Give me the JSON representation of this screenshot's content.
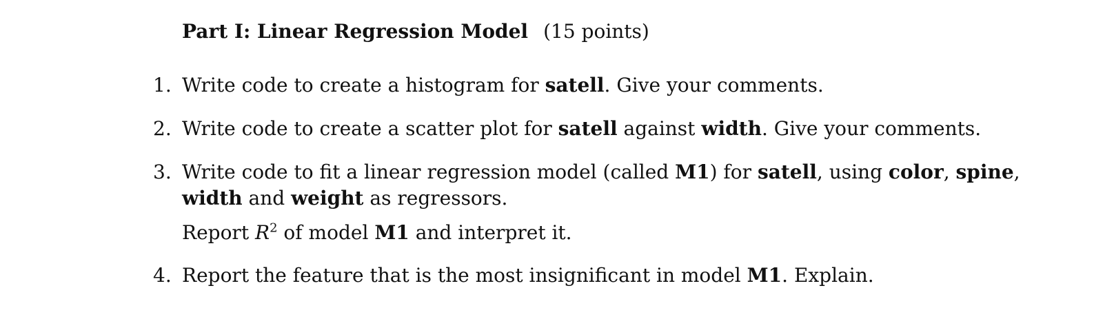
{
  "heading": {
    "title": "Part I: Linear Regression Model",
    "points": "(15 points)"
  },
  "items": [
    {
      "number": "1.",
      "t1": "Write code to create a histogram for ",
      "b1": "satell",
      "t2": ". Give your comments."
    },
    {
      "number": "2.",
      "t1": "Write code to create a scatter plot for ",
      "b1": "satell",
      "t2": " against ",
      "b2": "width",
      "t3": ". Give your comments."
    },
    {
      "number": "3.",
      "t1": "Write code to fit a linear regression model (called ",
      "b1": "M1",
      "t2": ") for ",
      "b2": "satell",
      "t3": ", using ",
      "b3": "color",
      "t4": ", ",
      "b4": "spine",
      "t5": ",",
      "b5": "width",
      "t6": " and ",
      "b6": "weight",
      "t7": " as regressors.",
      "p2_t1": "Report ",
      "p2_math": "R",
      "p2_sup": "2",
      "p2_t2": " of model ",
      "p2_b1": "M1",
      "p2_t3": " and interpret it."
    },
    {
      "number": "4.",
      "t1": "Report the feature that is the most insignificant in model ",
      "b1": "M1",
      "t2": ". Explain."
    }
  ]
}
